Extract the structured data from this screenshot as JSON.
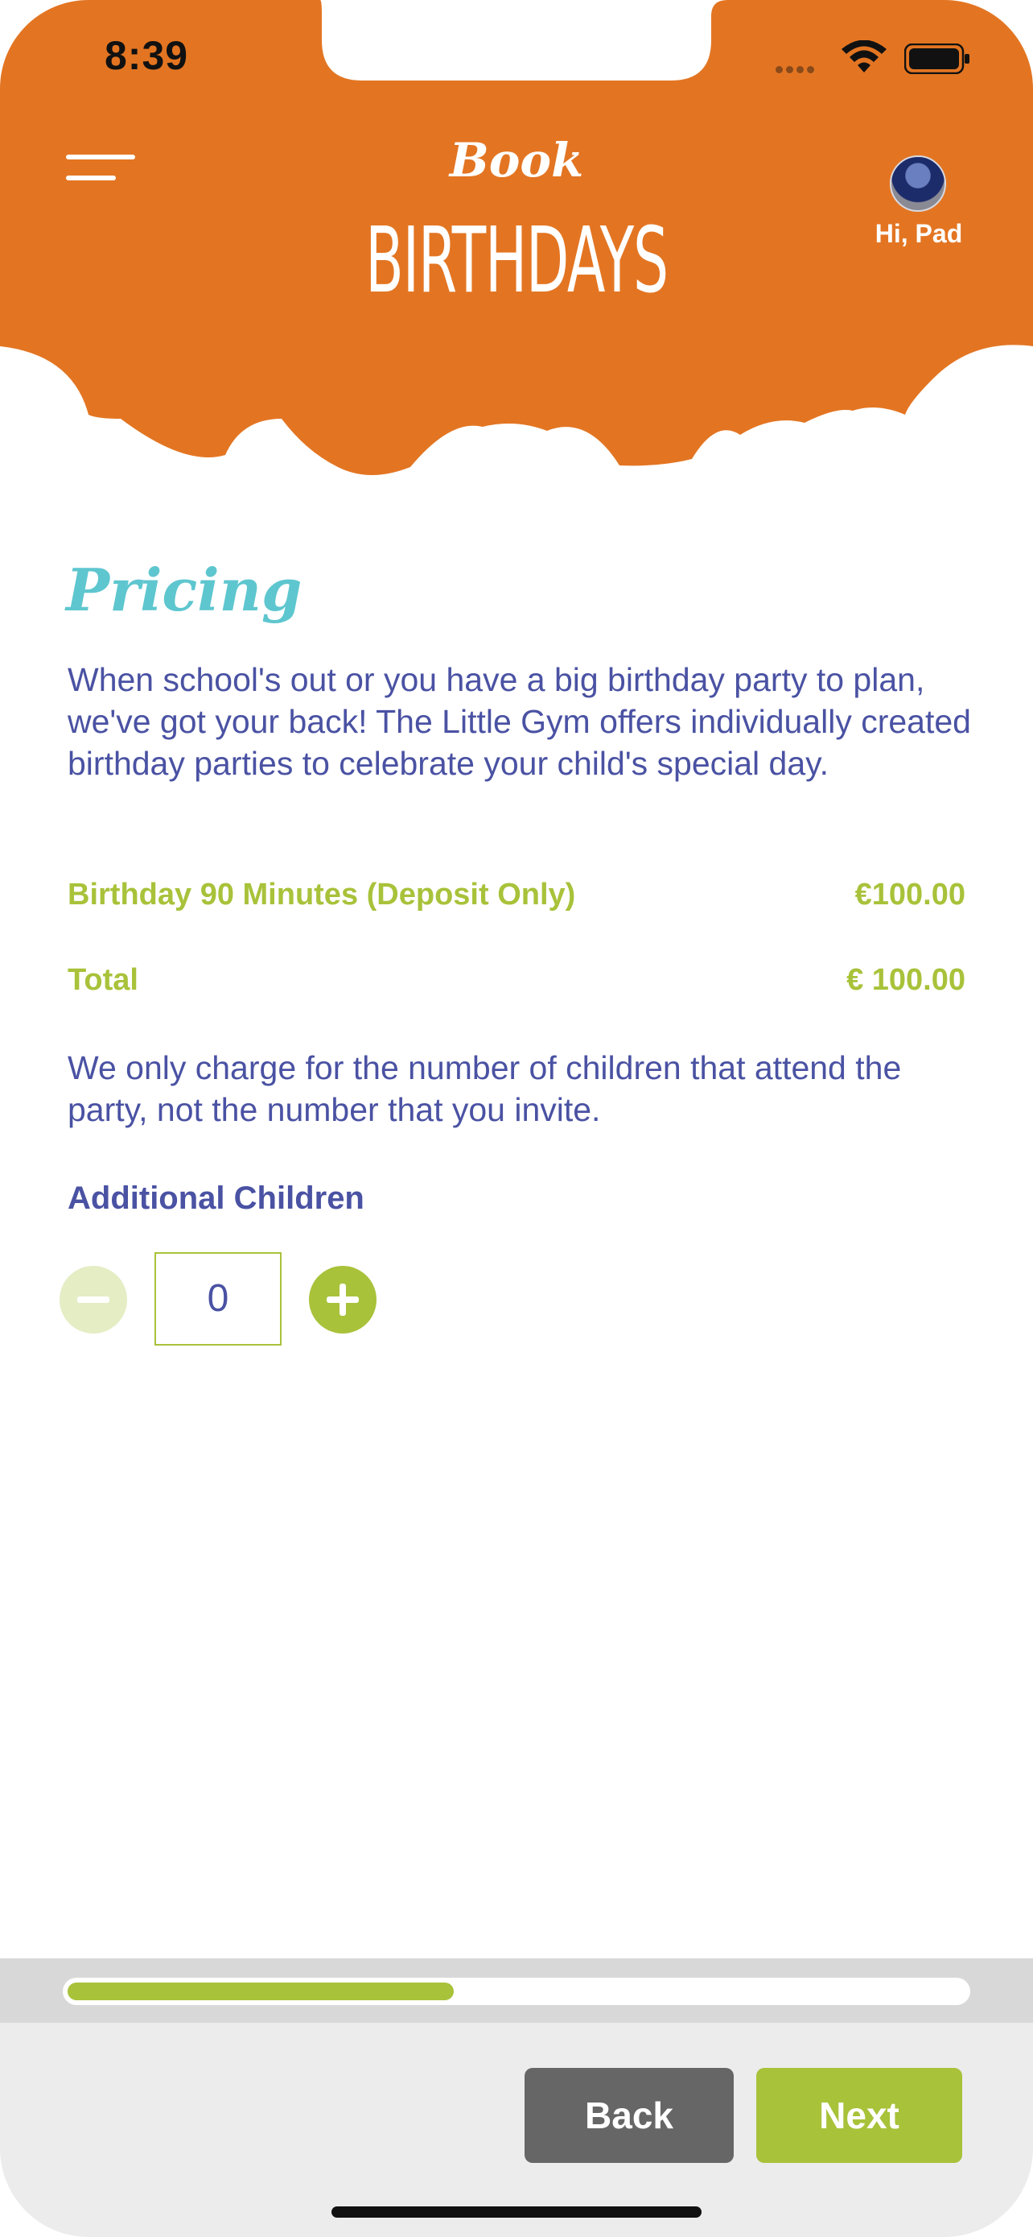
{
  "status_bar": {
    "time": "8:39"
  },
  "header": {
    "title_small": "Book",
    "title_big": "BIRTHDAYS",
    "greeting": "Hi, Pad",
    "brand_color": "#e37522"
  },
  "pricing": {
    "title": "Pricing",
    "intro": "When school's out or you have a big birthday party to plan, we've got your back! The Little Gym offers individually created birthday parties to celebrate your child's special day.",
    "line_item_label": "Birthday 90 Minutes (Deposit Only)",
    "line_item_value": "€100.00",
    "total_label": "Total",
    "total_value": "€ 100.00",
    "note": "We only charge for the number of children that attend the party, not the number that you invite.",
    "additional_children_label": "Additional Children",
    "additional_children_value": "0"
  },
  "footer": {
    "progress": 0.43,
    "back_label": "Back",
    "next_label": "Next",
    "accent_color": "#a8c23a"
  }
}
